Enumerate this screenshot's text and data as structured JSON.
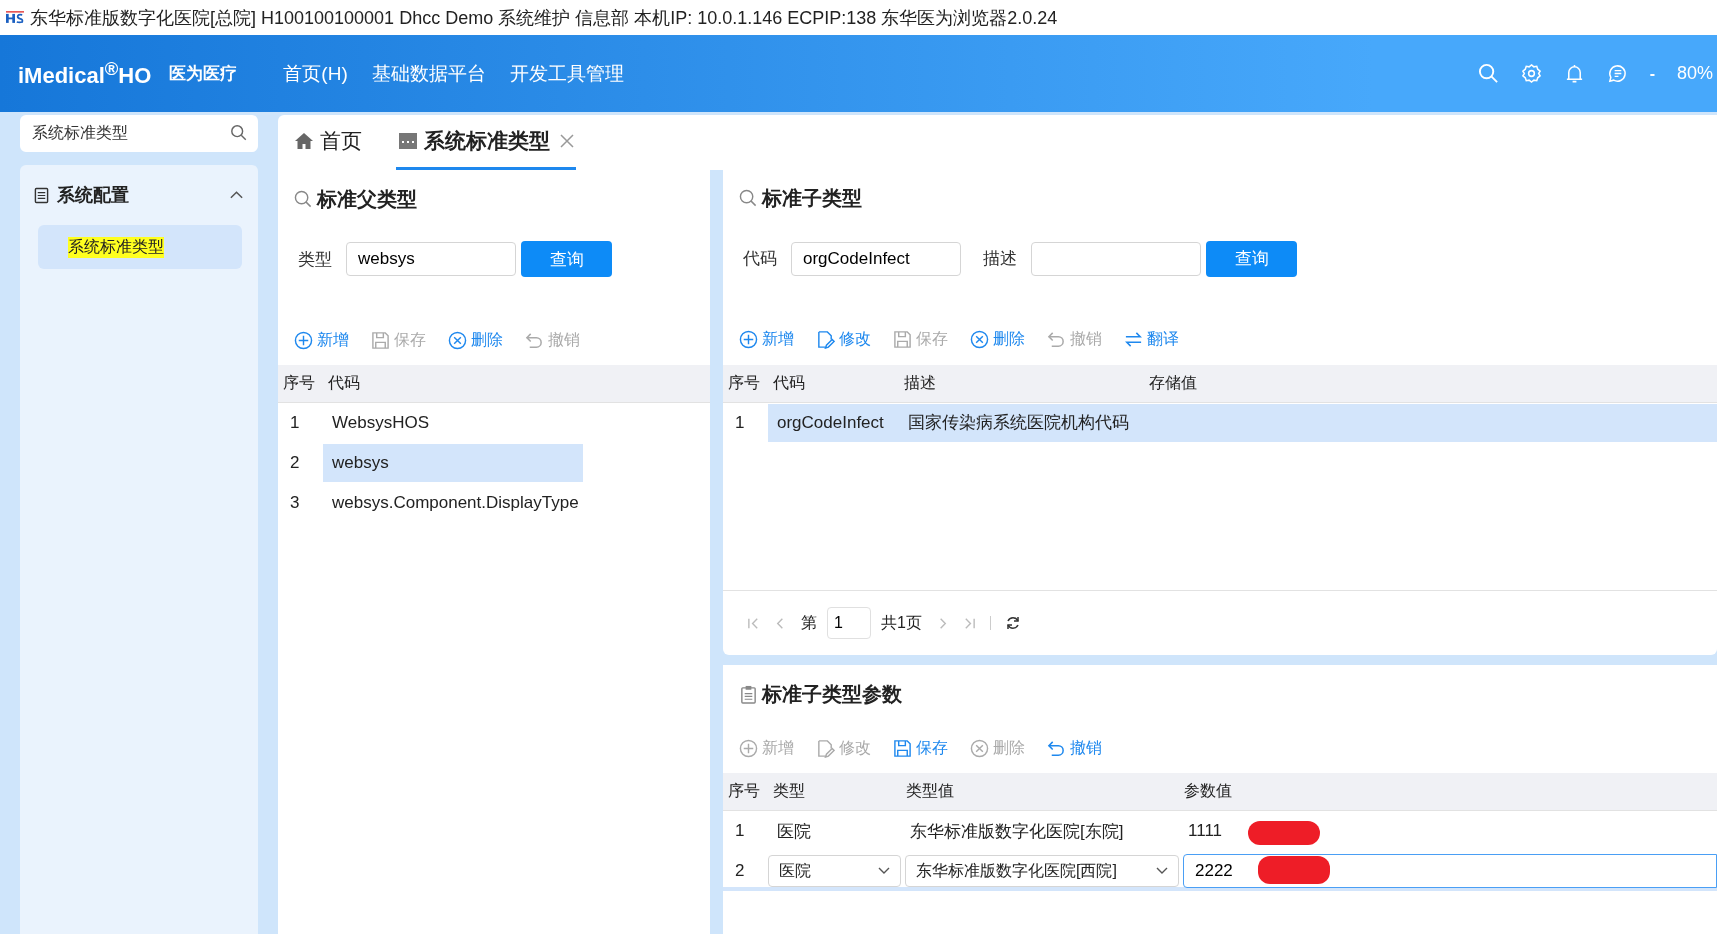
{
  "title_bar": {
    "text": "东华标准版数字化医院[总院] H100100100001 Dhcc Demo 系统维护 信息部 本机IP: 10.0.1.146 ECPIP:138 东华医为浏览器2.0.24"
  },
  "header": {
    "logo": "iMedical$^{®}$HO",
    "brand": "医为医疗",
    "nav": [
      {
        "label": "首页(H)"
      },
      {
        "label": "基础数据平台"
      },
      {
        "label": "开发工具管理"
      }
    ],
    "zoom_minus": "-",
    "zoom": "80%"
  },
  "sidebar": {
    "search": {
      "value": "系统标准类型"
    },
    "groups": [
      {
        "label": "系统配置",
        "expanded": true,
        "children": [
          {
            "label": "系统标准类型",
            "selected": true,
            "highlighted": true
          }
        ]
      }
    ]
  },
  "tabs": [
    {
      "label": "首页",
      "kind": "home",
      "selected": false,
      "closable": false
    },
    {
      "label": "系统标准类型",
      "kind": "page",
      "selected": true,
      "closable": true
    }
  ],
  "parent_panel": {
    "title": "标准父类型",
    "filters": [
      {
        "label": "类型",
        "value": "websys"
      }
    ],
    "query_button": "查询",
    "toolbar": [
      {
        "label": "新增",
        "kind": "add",
        "disabled": false
      },
      {
        "label": "保存",
        "kind": "save",
        "disabled": true
      },
      {
        "label": "删除",
        "kind": "delete",
        "disabled": false
      },
      {
        "label": "撤销",
        "kind": "undo",
        "disabled": true
      }
    ],
    "table": {
      "columns": [
        "序号",
        "代码"
      ],
      "rows": [
        {
          "cells": [
            "1",
            "WebsysHOS"
          ],
          "selected": false
        },
        {
          "cells": [
            "2",
            "websys"
          ],
          "selected": true
        },
        {
          "cells": [
            "3",
            "websys.Component.DisplayType"
          ],
          "selected": false
        }
      ]
    }
  },
  "child_panel": {
    "title": "标准子类型",
    "filters": [
      {
        "label": "代码",
        "value": "orgCodeInfect"
      },
      {
        "label": "描述"
      }
    ],
    "query_button": "查询",
    "toolbar": [
      {
        "label": "新增",
        "kind": "add",
        "disabled": false
      },
      {
        "label": "修改",
        "kind": "edit",
        "disabled": false
      },
      {
        "label": "保存",
        "kind": "save",
        "disabled": true
      },
      {
        "label": "删除",
        "kind": "delete",
        "disabled": false
      },
      {
        "label": "撤销",
        "kind": "undo",
        "disabled": true
      },
      {
        "label": "翻译",
        "kind": "translate",
        "disabled": false
      }
    ],
    "table": {
      "columns": [
        "序号",
        "代码",
        "描述",
        "存储值"
      ],
      "rows": [
        {
          "cells": [
            "1",
            "orgCodeInfect",
            "国家传染病系统医院机构代码"
          ],
          "selected": true
        }
      ]
    },
    "pager": {
      "page_label": "第",
      "page": "1",
      "total": "共1页"
    }
  },
  "param_panel": {
    "title": "标准子类型参数",
    "toolbar": [
      {
        "label": "新增",
        "kind": "add",
        "disabled": true
      },
      {
        "label": "修改",
        "kind": "edit",
        "disabled": true
      },
      {
        "label": "保存",
        "kind": "save",
        "disabled": false
      },
      {
        "label": "删除",
        "kind": "delete",
        "disabled": true
      },
      {
        "label": "撤销",
        "kind": "undo",
        "disabled": false
      }
    ],
    "table": {
      "columns": [
        "序号",
        "类型",
        "类型值",
        "参数值"
      ],
      "rows": [
        {
          "kind": "view",
          "cells": [
            "1",
            "医院",
            "东华标准版数字化医院[东院]",
            "1111"
          ],
          "selected": false,
          "redacted": true
        },
        {
          "kind": "edit",
          "cells": [
            "2",
            "医院",
            "东华标准版数字化医院[西院]",
            "2222"
          ],
          "selected": true,
          "redacted": true
        }
      ]
    }
  }
}
